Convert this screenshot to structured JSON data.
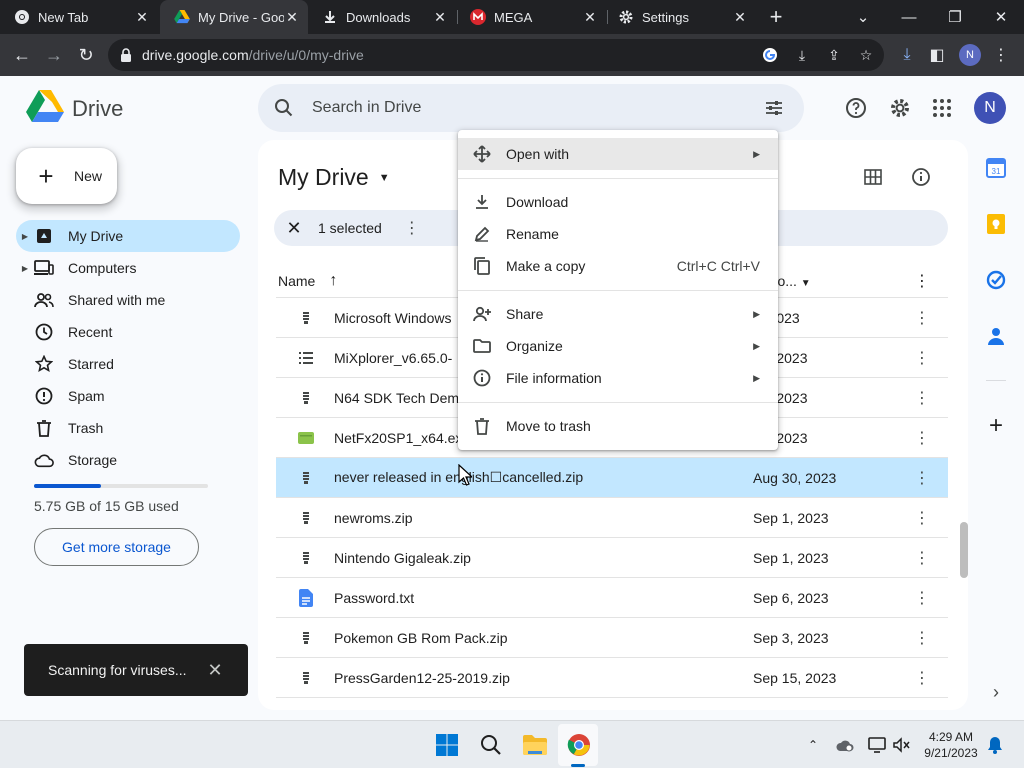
{
  "browser": {
    "tabs": [
      {
        "title": "New Tab",
        "icon": "chrome-icon"
      },
      {
        "title": "My Drive - Goo",
        "icon": "drive-icon"
      },
      {
        "title": "Downloads",
        "icon": "download-icon"
      },
      {
        "title": "MEGA",
        "icon": "mega-icon"
      },
      {
        "title": "Settings",
        "icon": "gear-icon"
      }
    ],
    "url_host": "drive.google.com",
    "url_path": "/drive/u/0/my-drive",
    "profile_initial": "N"
  },
  "header": {
    "app_name": "Drive",
    "search_placeholder": "Search in Drive",
    "avatar_initial": "N"
  },
  "sidebar": {
    "new_label": "New",
    "items": [
      {
        "label": "My Drive",
        "icon": "my-drive-icon",
        "active": true,
        "caret": true
      },
      {
        "label": "Computers",
        "icon": "computer-icon",
        "caret": true
      },
      {
        "label": "Shared with me",
        "icon": "people-icon"
      },
      {
        "label": "Recent",
        "icon": "clock-icon"
      },
      {
        "label": "Starred",
        "icon": "star-icon"
      },
      {
        "label": "Spam",
        "icon": "spam-icon"
      },
      {
        "label": "Trash",
        "icon": "trash-icon"
      },
      {
        "label": "Storage",
        "icon": "cloud-icon"
      }
    ],
    "storage_used_fraction": 0.383,
    "storage_text": "5.75 GB of 15 GB used",
    "get_storage_label": "Get more storage"
  },
  "toast": {
    "text": "Scanning for viruses..."
  },
  "main": {
    "title": "My Drive",
    "selection": {
      "count_label": "1 selected"
    },
    "columns": {
      "name": "Name",
      "modified": "t mo..."
    },
    "rows": [
      {
        "name": "Microsoft Windows",
        "date": "4, 2023",
        "icon": "zip-icon"
      },
      {
        "name": "MiXplorer_v6.65.0-",
        "date": "15, 2023",
        "icon": "list-icon"
      },
      {
        "name": "N64 SDK Tech Dem",
        "date": "30, 2023",
        "icon": "zip-icon"
      },
      {
        "name": "NetFx20SP1_x64.ex",
        "date": "15, 2023",
        "icon": "exe-icon"
      },
      {
        "name": "never released in english☐cancelled.zip",
        "date": "Aug 30, 2023",
        "icon": "zip-icon",
        "selected": true
      },
      {
        "name": "newroms.zip",
        "date": "Sep 1, 2023",
        "icon": "zip-icon"
      },
      {
        "name": "Nintendo Gigaleak.zip",
        "date": "Sep 1, 2023",
        "icon": "zip-icon"
      },
      {
        "name": "Password.txt",
        "date": "Sep 6, 2023",
        "icon": "doc-icon"
      },
      {
        "name": "Pokemon GB Rom Pack.zip",
        "date": "Sep 3, 2023",
        "icon": "zip-icon"
      },
      {
        "name": "PressGarden12-25-2019.zip",
        "date": "Sep 15, 2023",
        "icon": "zip-icon"
      }
    ]
  },
  "context_menu": {
    "items": [
      {
        "label": "Open with",
        "icon": "move-icon",
        "submenu": true,
        "hover": true
      },
      {
        "label": "Download",
        "icon": "download-icon"
      },
      {
        "label": "Rename",
        "icon": "pencil-icon"
      },
      {
        "label": "Make a copy",
        "icon": "copy-icon",
        "shortcut": "Ctrl+C Ctrl+V"
      },
      {
        "label": "Share",
        "icon": "person-add-icon",
        "submenu": true
      },
      {
        "label": "Organize",
        "icon": "folder-icon",
        "submenu": true
      },
      {
        "label": "File information",
        "icon": "info-icon",
        "submenu": true
      },
      {
        "label": "Move to trash",
        "icon": "trash-icon"
      }
    ]
  },
  "taskbar": {
    "time": "4:29 AM",
    "date": "9/21/2023"
  },
  "colors": {
    "accent": "#0b57d0",
    "selected_row": "#c2e7ff",
    "chrome_dark": "#202124"
  }
}
